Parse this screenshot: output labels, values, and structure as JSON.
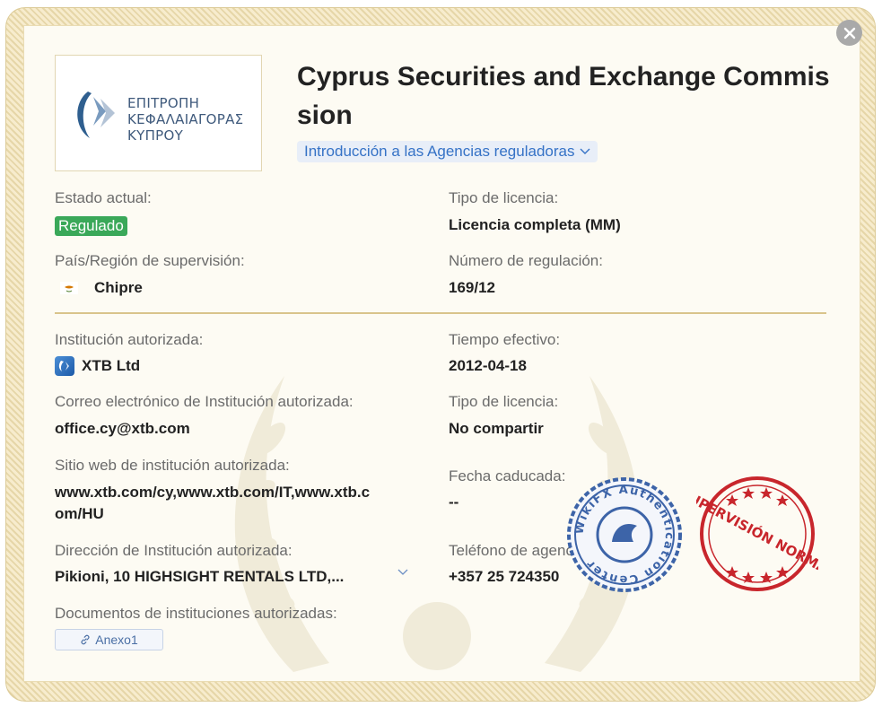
{
  "header": {
    "title": "Cyprus Securities and Exchange Commission",
    "agency_intro_link": "Introducción a las Agencias reguladoras"
  },
  "logo": {
    "lines": [
      "ΕΠΙΤΡΟΠΗ",
      "ΚΕΦΑΛΑΙΑΓΟΡΑΣ",
      "ΚΥΠΡΟΥ"
    ]
  },
  "fields": {
    "estado_label": "Estado actual:",
    "estado_value": "Regulado",
    "tipo_licencia_label": "Tipo de licencia:",
    "tipo_licencia_value": "Licencia completa (MM)",
    "pais_label": "País/Región de supervisión:",
    "pais_value": "Chipre",
    "numero_label": "Número de regulación:",
    "numero_value": "169/12",
    "institucion_label": "Institución autorizada:",
    "institucion_value": "XTB Ltd",
    "tiempo_label": "Tiempo efectivo:",
    "tiempo_value": "2012-04-18",
    "correo_label": "Correo electrónico de Institución autorizada:",
    "correo_value": "office.cy@xtb.com",
    "tipo_licencia2_label": "Tipo de licencia:",
    "tipo_licencia2_value": "No compartir",
    "sitio_label": "Sitio web de institución autorizada:",
    "sitio_value_line1": "www.xtb.com/cy,www.xtb.com/IT,www.xtb.c",
    "sitio_value_line2": "om/HU",
    "fecha_label": "Fecha caducada:",
    "fecha_value": "--",
    "direccion_label": "Dirección de Institución autorizada:",
    "direccion_value": "Pikioni, 10 HIGHSIGHT RENTALS LTD,...",
    "telefono_label": "Teléfono de agencia con licencia:",
    "telefono_value": "+357 25 724350",
    "documentos_label": "Documentos de instituciones autorizadas:",
    "anexo_label": "Anexo1"
  },
  "stamps": {
    "wikifx_text": "WikiFX Authentication Center",
    "supervision_text": "SUPERVISIÓN NORMAL"
  },
  "colors": {
    "regulated_badge": "#3aa859",
    "link_blue": "#3572c6",
    "stamp_blue": "#3d64a8",
    "stamp_red": "#c8262c"
  }
}
